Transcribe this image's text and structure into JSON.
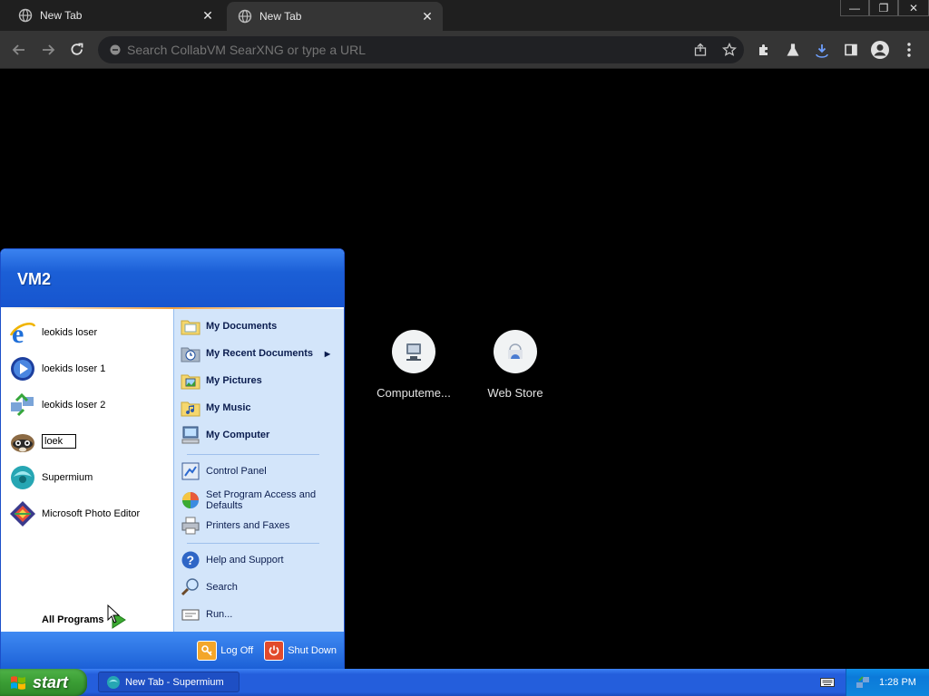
{
  "browser": {
    "tabs": [
      {
        "title": "New Tab",
        "active": false
      },
      {
        "title": "New Tab",
        "active": true
      }
    ],
    "omnibox_placeholder": "Search CollabVM SearXNG or type a URL",
    "window_controls": [
      "minimize",
      "restore",
      "close"
    ]
  },
  "shortcuts": [
    {
      "label": "Computeme...",
      "icon": "computer-icon"
    },
    {
      "label": "Web Store",
      "icon": "web-store-icon"
    }
  ],
  "startmenu": {
    "user": "VM2",
    "pinned": [
      {
        "label": "leokids loser",
        "icon": "internet-explorer-icon"
      },
      {
        "label": "loekids loser 1",
        "icon": "media-player-icon"
      },
      {
        "label": "leokids loser 2",
        "icon": "network-wizard-icon"
      },
      {
        "label": "",
        "icon": "raccoon-icon",
        "rename_value": "loek"
      },
      {
        "label": "Supermium",
        "icon": "supermium-icon"
      },
      {
        "label": "Microsoft Photo Editor",
        "icon": "photo-editor-icon"
      }
    ],
    "all_programs": "All Programs",
    "places": [
      {
        "label": "My Documents",
        "bold": true
      },
      {
        "label": "My Recent Documents",
        "bold": true
      },
      {
        "label": "My Pictures",
        "bold": true
      },
      {
        "label": "My Music",
        "bold": true
      },
      {
        "label": "My Computer",
        "bold": true
      }
    ],
    "system": [
      {
        "label": "Control Panel"
      },
      {
        "label": "Set Program Access and Defaults"
      },
      {
        "label": "Printers and Faxes"
      }
    ],
    "help": [
      {
        "label": "Help and Support"
      },
      {
        "label": "Search"
      },
      {
        "label": "Run..."
      }
    ],
    "logoff": "Log Off",
    "shutdown": "Shut Down"
  },
  "taskbar": {
    "start_label": "start",
    "task_item": "New Tab - Supermium",
    "clock": "1:28 PM"
  },
  "colors": {
    "xp_blue": "#245edc",
    "start_green": "#3a9d34",
    "places_bg": "#d3e5fa"
  }
}
